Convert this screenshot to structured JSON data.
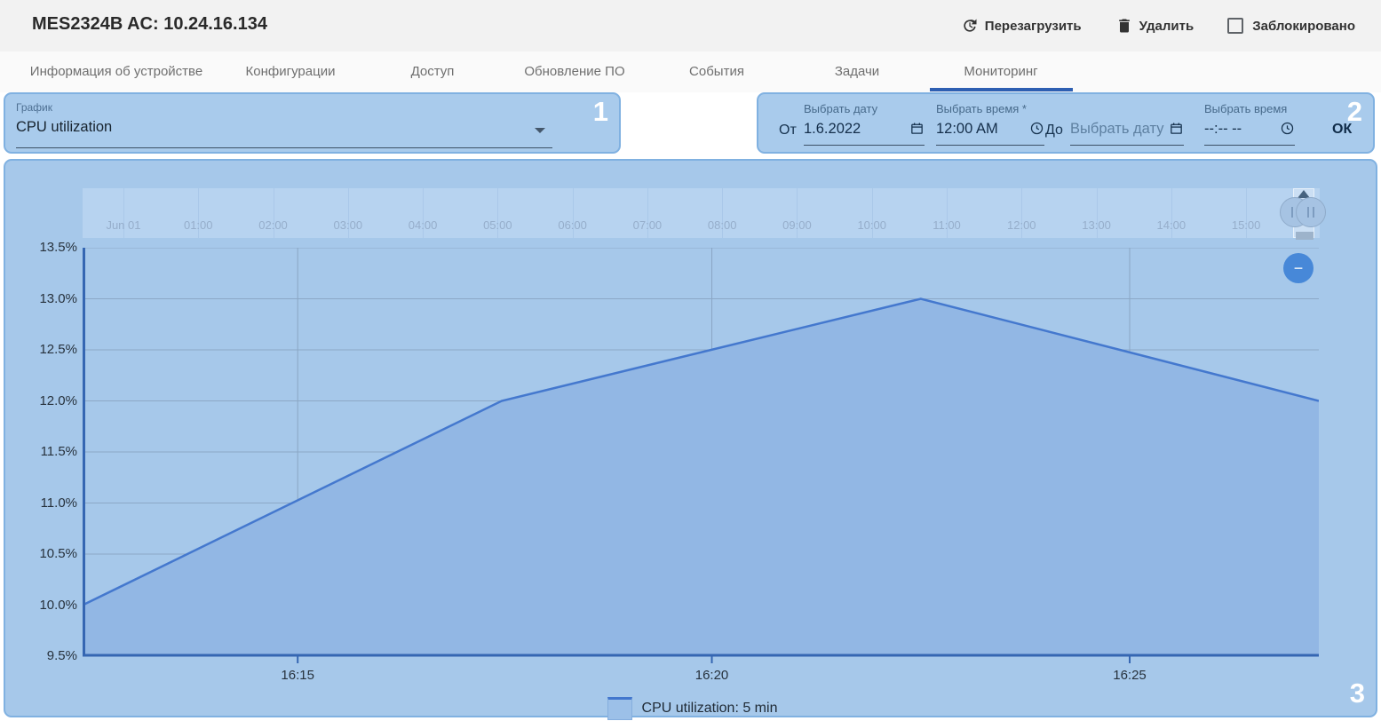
{
  "header": {
    "title": "MES2324B AC: 10.24.16.134",
    "reload_label": "Перезагрузить",
    "delete_label": "Удалить",
    "locked_label": "Заблокировано",
    "locked_checked": false
  },
  "tabs": {
    "items": [
      {
        "label": "Информация об устройстве"
      },
      {
        "label": "Конфигурации"
      },
      {
        "label": "Доступ"
      },
      {
        "label": "Обновление ПО"
      },
      {
        "label": "События"
      },
      {
        "label": "Задачи"
      },
      {
        "label": "Мониторинг"
      }
    ],
    "active_label": "Мониторинг"
  },
  "regions": {
    "one": "1",
    "two": "2",
    "three": "3"
  },
  "chart_select": {
    "label": "График",
    "value": "CPU utilization"
  },
  "range_form": {
    "from_label": "От",
    "to_label": "До",
    "date_from": {
      "label": "Выбрать дату",
      "value": "1.6.2022"
    },
    "time_from": {
      "label": "Выбрать время *",
      "value": "12:00 AM"
    },
    "date_to": {
      "label": "Выбрать дату",
      "placeholder": "Выбрать дату"
    },
    "time_to": {
      "label": "Выбрать время",
      "value": "--:-- --"
    },
    "ok_label": "ОК"
  },
  "chart_data": {
    "type": "area",
    "title": "CPU utilization",
    "ylim": [
      9.5,
      13.5
    ],
    "yticks": [
      "13.5%",
      "13.0%",
      "12.5%",
      "12.0%",
      "11.5%",
      "11.0%",
      "10.5%",
      "10.0%",
      "9.5%"
    ],
    "xticks": [
      {
        "label": "16:15",
        "xf": 0.174
      },
      {
        "label": "16:20",
        "xf": 0.509
      },
      {
        "label": "16:25",
        "xf": 0.847
      }
    ],
    "series": [
      {
        "name": "CPU utilization: 5 min",
        "points": [
          {
            "xf": 0.0,
            "value": 10.0
          },
          {
            "xf": 0.339,
            "value": 12.0
          },
          {
            "xf": 0.678,
            "value": 13.0
          },
          {
            "xf": 1.0,
            "value": 12.0
          }
        ]
      }
    ],
    "legend": [
      {
        "label": "CPU utilization: 5 min"
      }
    ],
    "legend_position": "bottom-center",
    "grid": true,
    "navigator": {
      "ticks": [
        "Jun 01",
        "01:00",
        "02:00",
        "03:00",
        "04:00",
        "05:00",
        "06:00",
        "07:00",
        "08:00",
        "09:00",
        "10:00",
        "11:00",
        "12:00",
        "13:00",
        "14:00",
        "15:00"
      ],
      "first_tick_xf": 0.033,
      "tick_step_xf": 0.0605
    }
  }
}
